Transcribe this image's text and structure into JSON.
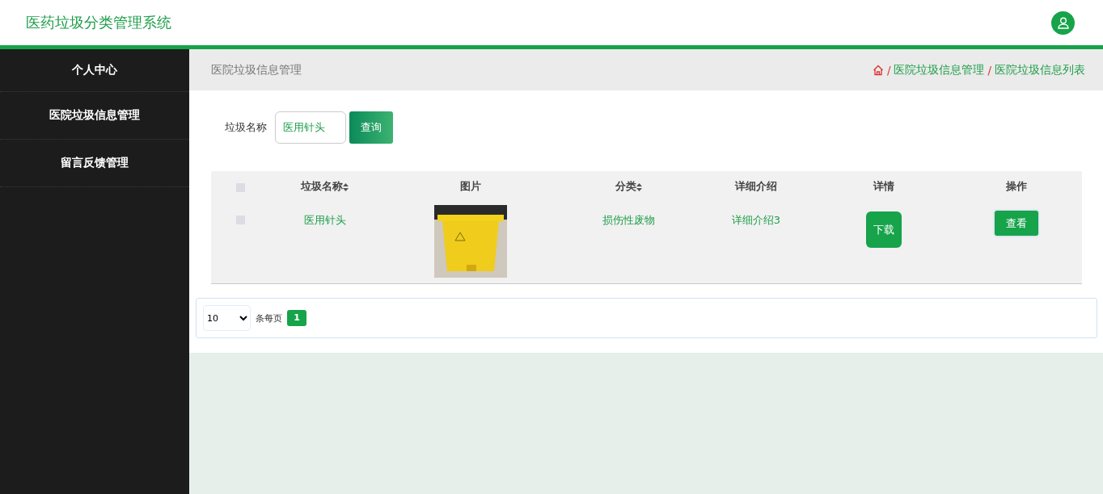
{
  "header": {
    "title": "医药垃圾分类管理系统"
  },
  "sidebar": {
    "items": [
      {
        "label": "个人中心"
      },
      {
        "label": "医院垃圾信息管理"
      },
      {
        "label": "留言反馈管理"
      }
    ]
  },
  "page_title": "医院垃圾信息管理",
  "breadcrumb_separator": "/",
  "breadcrumb": [
    "医院垃圾信息管理",
    "医院垃圾信息列表"
  ],
  "search": {
    "label": "垃圾名称",
    "value": "医用针头",
    "button": "查询"
  },
  "table": {
    "select_all": {
      "checked": false
    },
    "columns": [
      {
        "label": "垃圾名称",
        "sortable": true
      },
      {
        "label": "图片",
        "sortable": false
      },
      {
        "label": "分类",
        "sortable": true
      },
      {
        "label": "详细介绍",
        "sortable": false
      },
      {
        "label": "详情",
        "sortable": false
      },
      {
        "label": "操作",
        "sortable": false
      }
    ],
    "rows": [
      {
        "checked": false,
        "name": "医用针头",
        "category": "损伤性废物",
        "description": "详细介绍3",
        "detail_button": "下载",
        "action_button": "查看"
      }
    ]
  },
  "pager": {
    "page_size": "10",
    "page_size_suffix": "条每页",
    "pages": [
      {
        "label": "1",
        "selected": true
      }
    ]
  }
}
